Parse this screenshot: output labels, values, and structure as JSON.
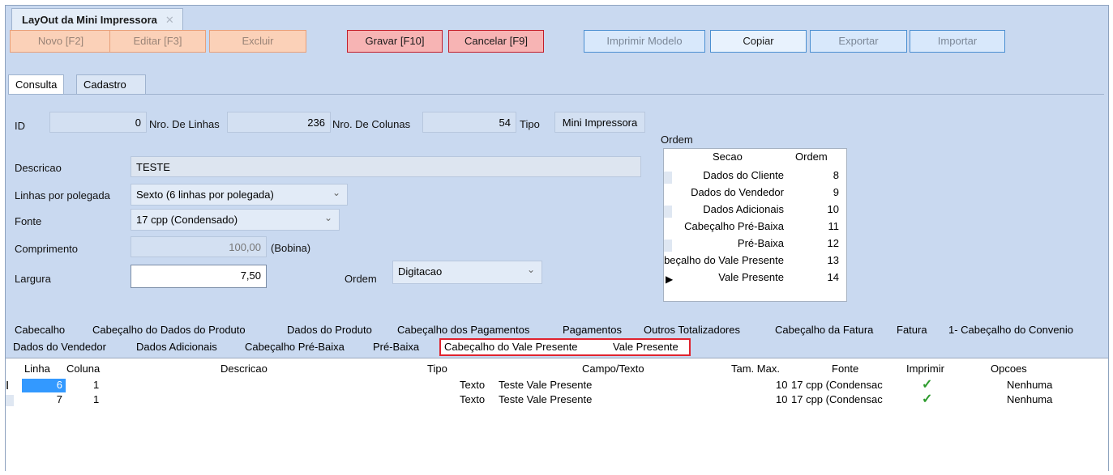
{
  "window": {
    "title": "LayOut da Mini Impressora",
    "close": "✕"
  },
  "toolbar": {
    "novo": "Novo [F2]",
    "editar": "Editar [F3]",
    "excluir": "Excluir",
    "gravar": "Gravar [F10]",
    "cancelar": "Cancelar [F9]",
    "imprimir": "Imprimir Modelo",
    "copiar": "Copiar",
    "exportar": "Exportar",
    "importar": "Importar"
  },
  "tabs": {
    "consulta": "Consulta",
    "cadastro": "Cadastro"
  },
  "form": {
    "id_label": "ID",
    "id_value": "0",
    "linhas_label": "Nro. De Linhas",
    "linhas_value": "236",
    "colunas_label": "Nro. De Colunas",
    "colunas_value": "54",
    "tipo_label": "Tipo",
    "tipo_value": "Mini Impressora",
    "descricao_label": "Descricao",
    "descricao_value": "TESTE",
    "lpp_label": "Linhas por polegada",
    "lpp_value": "Sexto  (6 linhas por polegada)",
    "fonte_label": "Fonte",
    "fonte_value": "17 cpp (Condensado)",
    "comprimento_label": "Comprimento",
    "comprimento_value": "100,00",
    "bobina": "(Bobina)",
    "largura_label": "Largura",
    "largura_value": "7,50",
    "ordem_label": "Ordem",
    "ordem_value": "Digitacao"
  },
  "ordem": {
    "title": "Ordem",
    "col_secao": "Secao",
    "col_ordem": "Ordem",
    "rows": [
      {
        "secao": "Dados do Cliente",
        "ordem": "8"
      },
      {
        "secao": "Dados do Vendedor",
        "ordem": "9"
      },
      {
        "secao": "Dados Adicionais",
        "ordem": "10"
      },
      {
        "secao": "Cabeçalho Pré-Baixa",
        "ordem": "11"
      },
      {
        "secao": "Pré-Baixa",
        "ordem": "12"
      },
      {
        "secao": "Cabeçalho do Vale Presente",
        "ordem": "13"
      },
      {
        "secao": "Vale Presente",
        "ordem": "14"
      }
    ]
  },
  "section_tabs_1": [
    "Cabecalho",
    "Cabeçalho do Dados do Produto",
    "Dados do Produto",
    "Cabeçalho dos Pagamentos",
    "Pagamentos",
    "Outros Totalizadores",
    "Cabeçalho da Fatura",
    "Fatura",
    "1- Cabeçalho do Convenio"
  ],
  "section_tabs_2": [
    "Dados do Vendedor",
    "Dados Adicionais",
    "Cabeçalho Pré-Baixa",
    "Pré-Baixa",
    "Cabeçalho do Vale Presente",
    "Vale Presente"
  ],
  "grid": {
    "headers": {
      "linha": "Linha",
      "coluna": "Coluna",
      "descricao": "Descricao",
      "tipo": "Tipo",
      "campo": "Campo/Texto",
      "tam": "Tam. Max.",
      "fonte": "Fonte",
      "imprimir": "Imprimir",
      "opcoes": "Opcoes"
    },
    "rows": [
      {
        "linha": "6",
        "coluna": "1",
        "descricao": "",
        "tipo": "Texto",
        "campo": "Teste Vale Presente",
        "tam": "10",
        "fonte": "17 cpp (Condensac",
        "imprimir": "✓",
        "opcoes": "Nenhuma"
      },
      {
        "linha": "7",
        "coluna": "1",
        "descricao": "",
        "tipo": "Texto",
        "campo": "Teste Vale Presente",
        "tam": "10",
        "fonte": "17 cpp (Condensac",
        "imprimir": "✓",
        "opcoes": "Nenhuma"
      }
    ]
  },
  "colors": {
    "highlight": "#e0232e",
    "panel": "#c9d9f0",
    "selection": "#3399ff"
  }
}
